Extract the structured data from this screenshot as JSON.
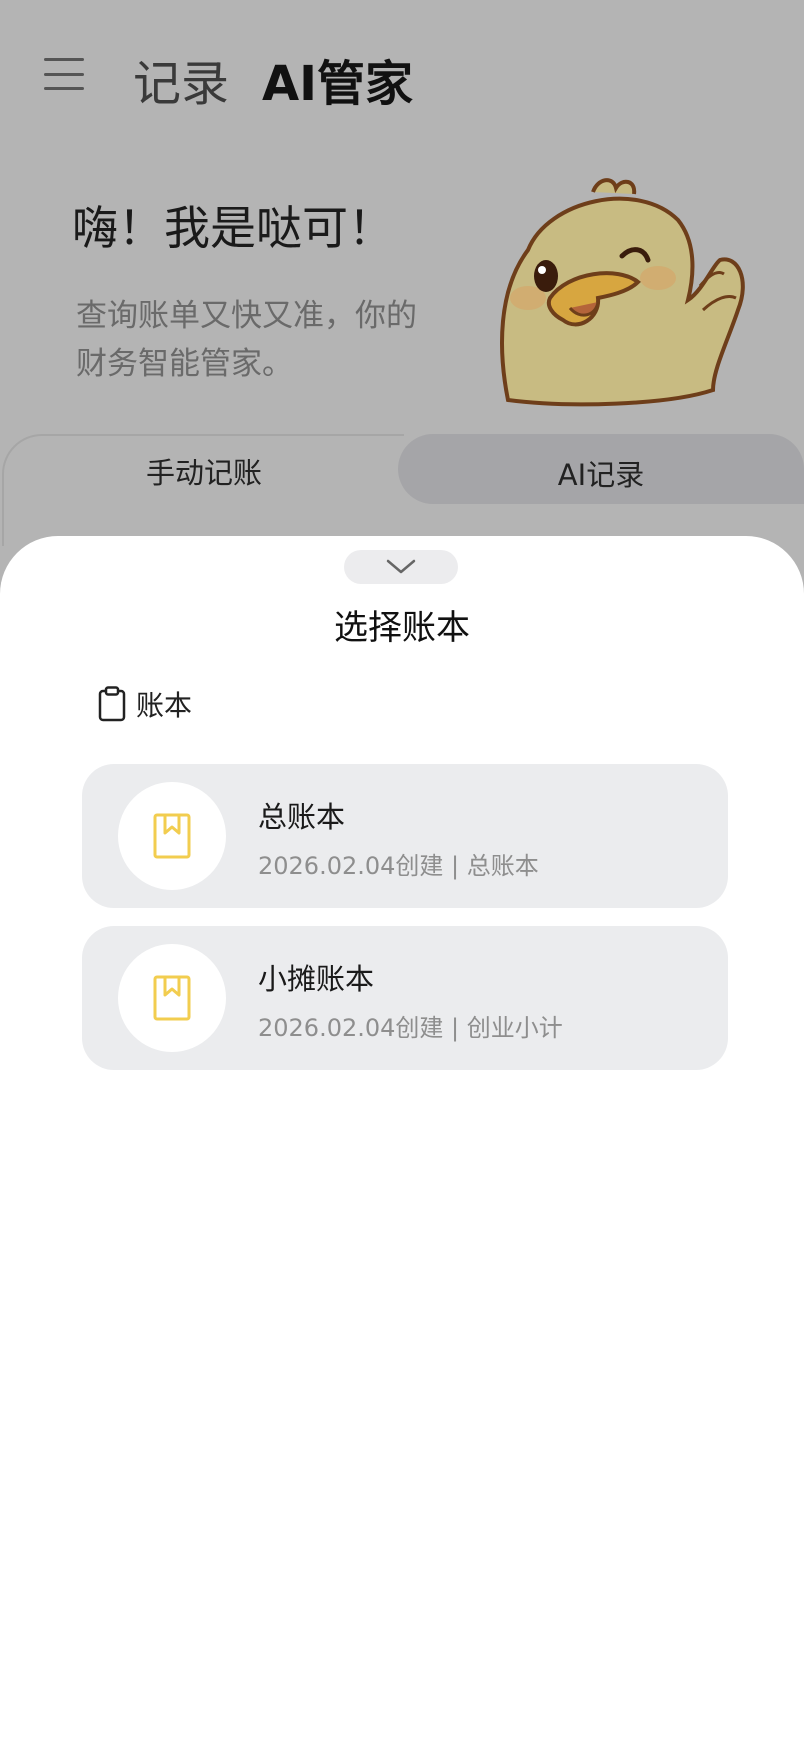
{
  "header": {
    "menu_icon": "hamburger-menu-icon",
    "tab_record": "记录",
    "tab_ai": "AI管家"
  },
  "hero": {
    "title": "嗨！我是哒可！",
    "subtitle": "查询账单又快又准，你的财务智能管家。",
    "mascot": "duck-mascot"
  },
  "modes": {
    "manual": "手动记账",
    "ai": "AI记录"
  },
  "sheet": {
    "handle_icon": "chevron-down-icon",
    "title": "选择账本",
    "section_icon": "clipboard-icon",
    "section_label": "账本",
    "books": [
      {
        "name": "总账本",
        "meta": "2026.02.04创建 | 总账本",
        "icon": "book-icon",
        "icon_color": "#f2cd4f"
      },
      {
        "name": "小摊账本",
        "meta": "2026.02.04创建 | 创业小计",
        "icon": "book-icon",
        "icon_color": "#f2cd4f"
      }
    ]
  },
  "colors": {
    "overlay_bg": "#b4b4b4",
    "card_bg": "#ebecee",
    "accent_yellow": "#f2cd4f"
  }
}
